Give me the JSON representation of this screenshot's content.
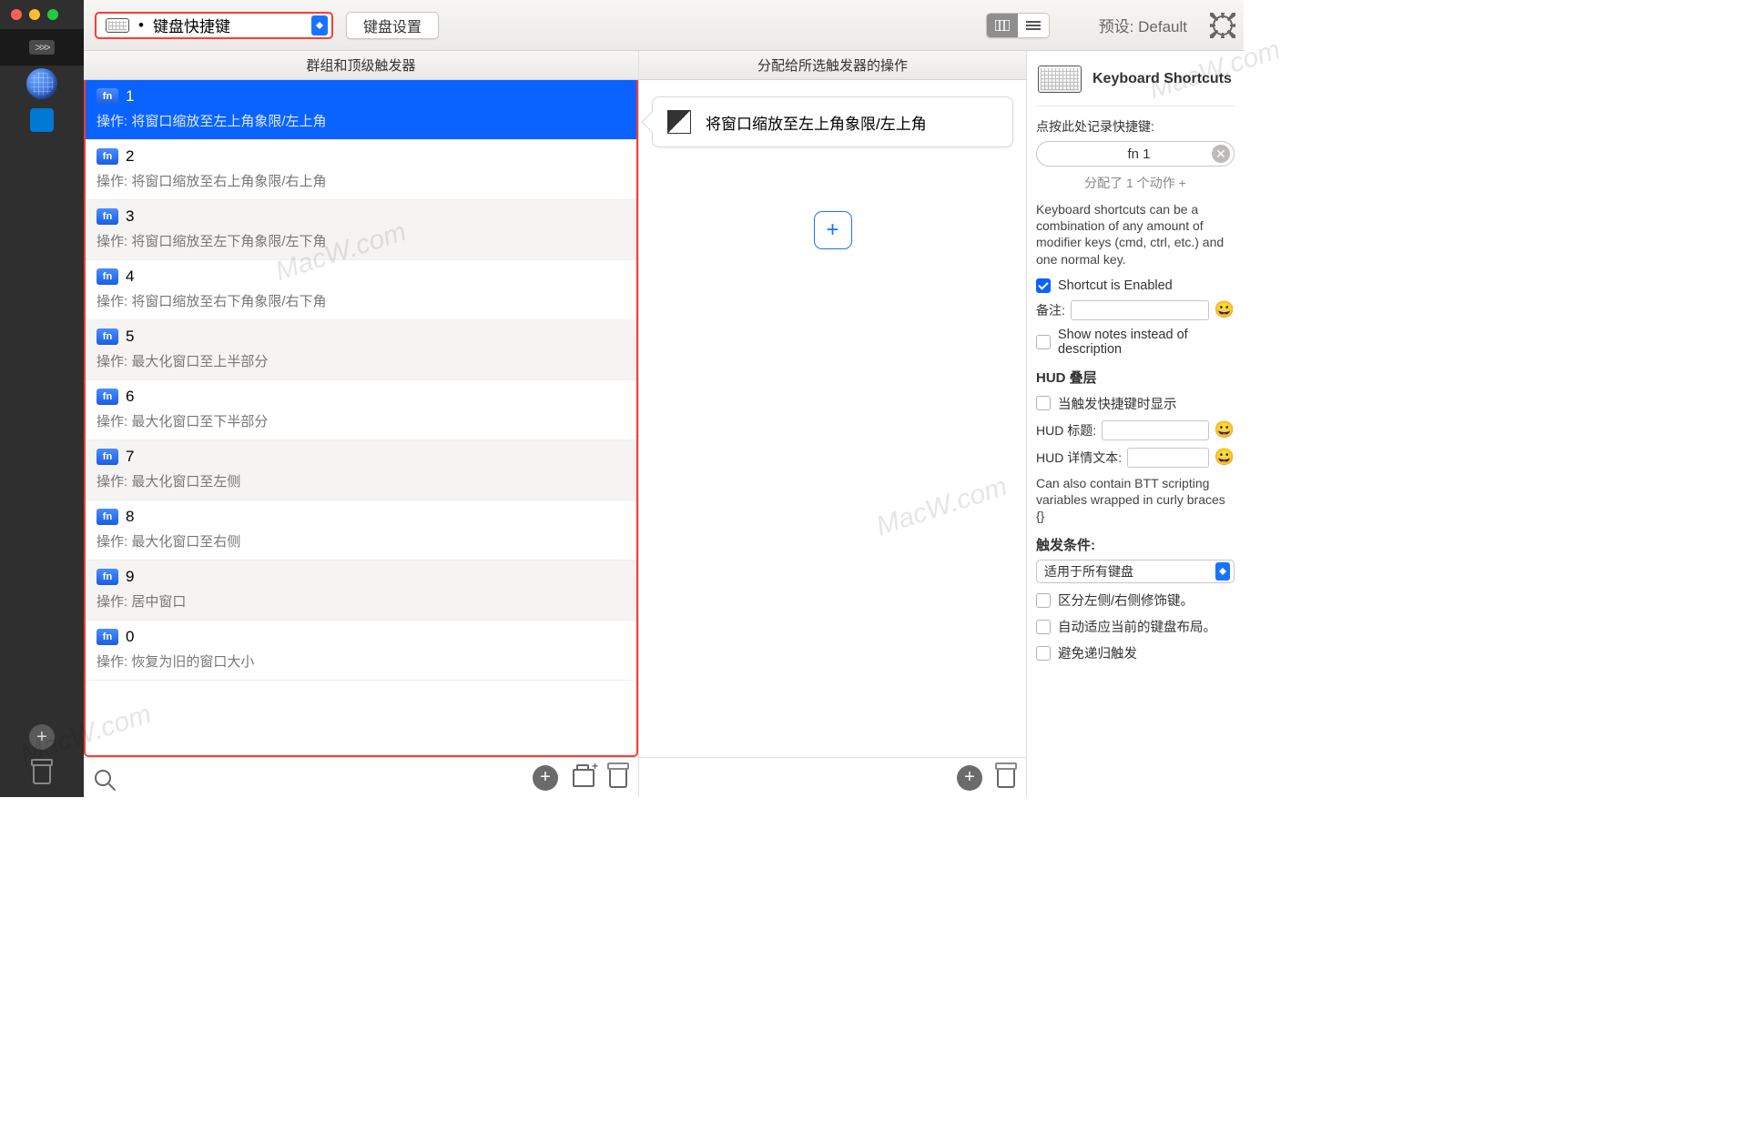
{
  "toolbar": {
    "dropdown_label": "键盘快捷键",
    "settings_button": "键盘设置",
    "preset_label": "预设: Default"
  },
  "columns": {
    "triggers_header": "群组和顶级触发器",
    "actions_header": "分配给所选触发器的操作"
  },
  "triggers": [
    {
      "key": "1",
      "action": "操作: 将窗口缩放至左上角象限/左上角",
      "selected": true
    },
    {
      "key": "2",
      "action": "操作: 将窗口缩放至右上角象限/右上角"
    },
    {
      "key": "3",
      "action": "操作: 将窗口缩放至左下角象限/左下角"
    },
    {
      "key": "4",
      "action": "操作: 将窗口缩放至右下角象限/右下角"
    },
    {
      "key": "5",
      "action": "操作: 最大化窗口至上半部分"
    },
    {
      "key": "6",
      "action": "操作: 最大化窗口至下半部分"
    },
    {
      "key": "7",
      "action": "操作: 最大化窗口至左侧"
    },
    {
      "key": "8",
      "action": "操作: 最大化窗口至右侧"
    },
    {
      "key": "9",
      "action": "操作: 居中窗口"
    },
    {
      "key": "0",
      "action": "操作: 恢复为旧的窗口大小"
    }
  ],
  "action_card": {
    "title": "将窗口缩放至左上角象限/左上角"
  },
  "inspector": {
    "title": "Keyboard Shortcuts",
    "record_hint": "点按此处记录快捷键:",
    "recorded": "fn 1",
    "assigned": "分配了 1 个动作 +",
    "help_text": "Keyboard shortcuts can be a combination of any amount of modifier keys (cmd, ctrl, etc.) and one normal key.",
    "enabled_label": "Shortcut is Enabled",
    "notes_label": "备注:",
    "show_notes_label": "Show notes instead of description",
    "hud_section": "HUD 叠层",
    "hud_show": "当触发快捷键时显示",
    "hud_title_label": "HUD 标题:",
    "hud_detail_label": "HUD 详情文本:",
    "hud_help": "Can also contain BTT scripting variables wrapped in curly braces {}",
    "cond_section": "触发条件:",
    "cond_select": "适用于所有键盘",
    "cond_lr": "区分左侧/右侧修饰键。",
    "cond_adapt": "自动适应当前的键盘布局。",
    "cond_avoid": "避免递归触发"
  },
  "watermark": "MacW.com"
}
